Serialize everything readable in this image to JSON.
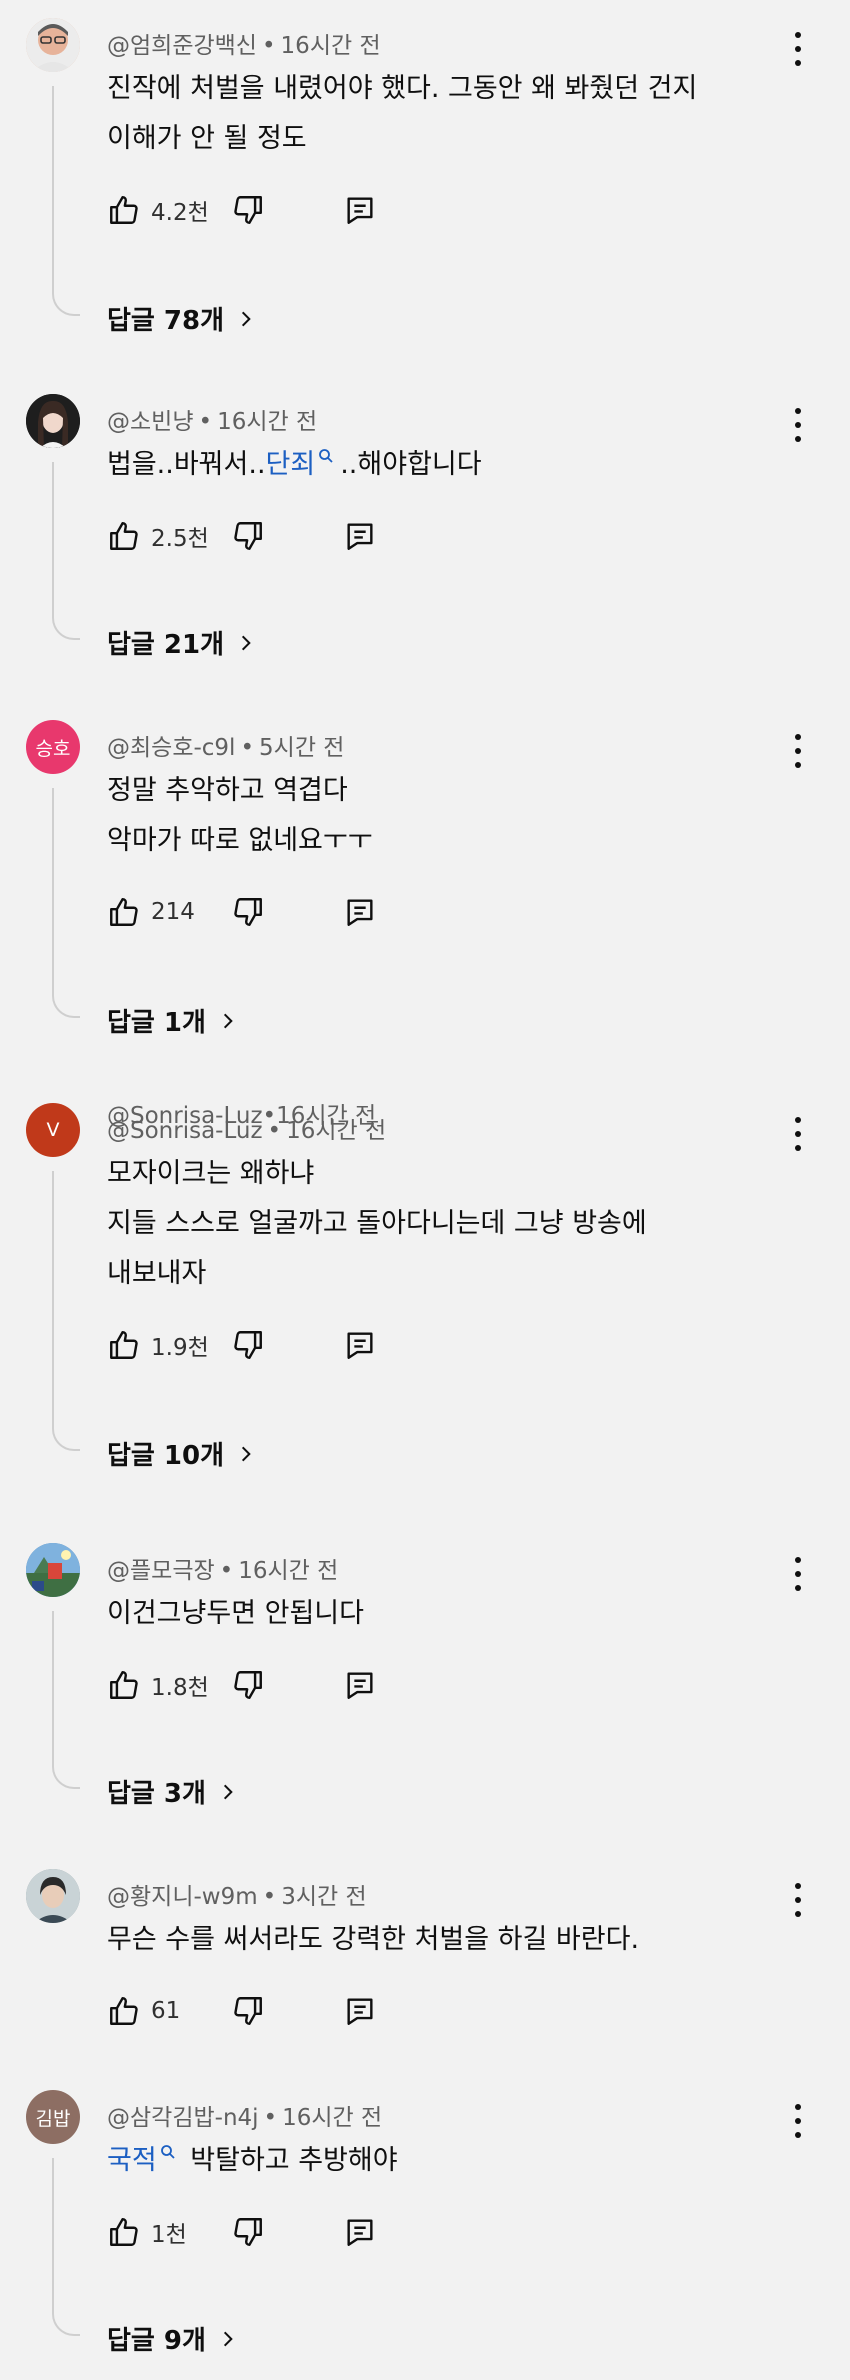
{
  "comments": [
    {
      "author": "@엄희준강백신",
      "time": "16시간 전",
      "avatar": {
        "icon": "person-photo-avatar",
        "bg": "#e7b39a"
      },
      "lines": [
        "진작에 처벌을 내렸어야 했다. 그동안 왜 봐줬던 건지",
        "이해가 안 될 정도"
      ],
      "likes": "4.2천",
      "replies": "답글 78개"
    },
    {
      "author": "@소빈냥",
      "time": "16시간 전",
      "avatar": {
        "icon": "person-photo-avatar",
        "bg": "#2b2b2b"
      },
      "text_before": "법을..바꿔서..",
      "link_text": "단죄",
      "text_after": "..해야합니다",
      "likes": "2.5천",
      "replies": "답글 21개"
    },
    {
      "author": "@최승호-c9l",
      "time": "5시간 전",
      "avatar": {
        "letters": "승호",
        "bg": "#e8386d"
      },
      "lines": [
        "정말 추악하고 역겹다",
        "악마가 따로 없네요ㅜㅜ"
      ],
      "likes": "214",
      "replies": "답글 1개"
    },
    {
      "author": "@Sonrisa-Luz",
      "time": "16시간 전",
      "avatar": {
        "letters": "V",
        "bg": "#c0391a"
      },
      "lines": [
        "모자이크는 왜하냐",
        "지들 스스로 얼굴까고 돌아다니는데 그냥 방송에",
        "내보내자"
      ],
      "likes": "1.9천",
      "replies": "답글 10개"
    },
    {
      "author": "@플모극장",
      "time": "16시간 전",
      "avatar": {
        "icon": "landscape-photo-avatar",
        "bg": "#5a89b5"
      },
      "lines": [
        "이건그냥두면 안됩니다"
      ],
      "likes": "1.8천",
      "replies": "답글 3개"
    },
    {
      "author": "@황지니-w9m",
      "time": "3시간 전",
      "avatar": {
        "icon": "person-photo-avatar",
        "bg": "#8c9a9e"
      },
      "lines": [
        "무슨 수를 써서라도 강력한 처벌을 하길 바란다."
      ],
      "likes": "61",
      "replies": ""
    },
    {
      "author": "@삼각김밥-n4j",
      "time": "16시간 전",
      "avatar": {
        "letters": "김밥",
        "bg": "#8d6e63"
      },
      "link_text": "국적",
      "text_after": " 박탈하고 추방해야",
      "likes": "1천",
      "replies": "답글 9개"
    }
  ],
  "icons": {
    "like": "thumbs-up-icon",
    "dislike": "thumbs-down-icon",
    "reply": "reply-icon",
    "more": "more-vert-icon",
    "chevron": "chevron-right-icon",
    "search": "search-icon"
  }
}
